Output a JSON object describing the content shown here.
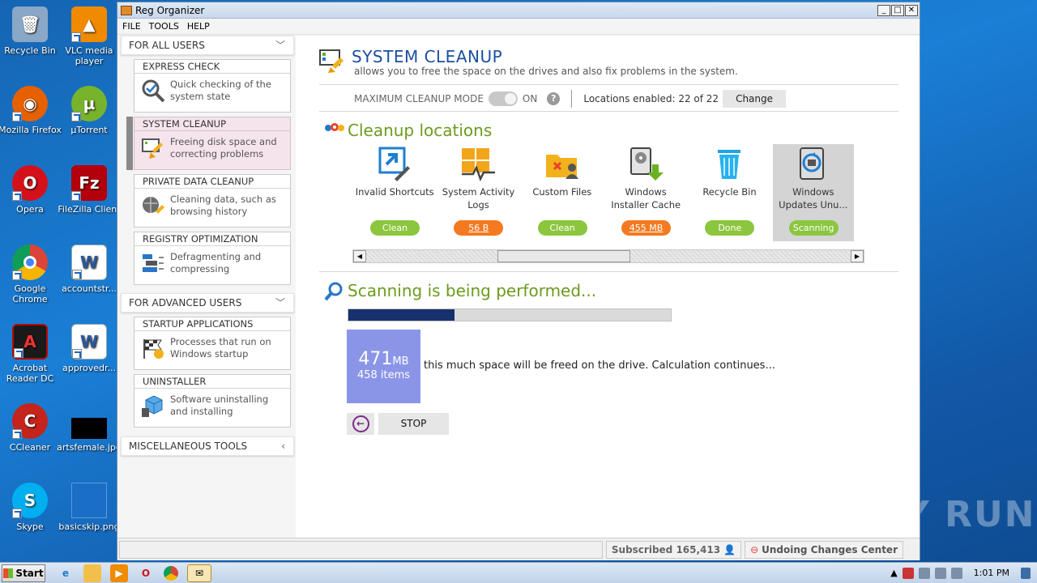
{
  "desktop": {
    "icons": [
      {
        "label": "Recycle Bin",
        "color": "#6e8db3"
      },
      {
        "label": "VLC media player",
        "color": "#f08a00"
      },
      {
        "label": "Mozilla Firefox",
        "color": "#e66000"
      },
      {
        "label": "µTorrent",
        "color": "#78b32c"
      },
      {
        "label": "Opera",
        "color": "#d4111b"
      },
      {
        "label": "FileZilla Client",
        "color": "#b3000c"
      },
      {
        "label": "Google Chrome",
        "color": "#4285f4"
      },
      {
        "label": "accountstr...",
        "color": "#2b5797"
      },
      {
        "label": "Acrobat Reader DC",
        "color": "#b30b00"
      },
      {
        "label": "approvedr...",
        "color": "#2b5797"
      },
      {
        "label": "CCleaner",
        "color": "#c4241c"
      },
      {
        "label": "artsfemale.jpg",
        "color": "#000000"
      },
      {
        "label": "Skype",
        "color": "#00aff0"
      },
      {
        "label": "basicskip.png",
        "color": "#1a6ec5"
      }
    ]
  },
  "window": {
    "title": "Reg Organizer",
    "menu": [
      "FILE",
      "TOOLS",
      "HELP"
    ]
  },
  "sidebar": {
    "section_all_users": "FOR ALL USERS",
    "section_advanced": "FOR ADVANCED USERS",
    "section_misc": "MISCELLANEOUS TOOLS",
    "cards": [
      {
        "title": "EXPRESS CHECK",
        "desc": "Quick checking of the system state"
      },
      {
        "title": "SYSTEM CLEANUP",
        "desc": "Freeing disk space and correcting problems"
      },
      {
        "title": "PRIVATE DATA CLEANUP",
        "desc": "Cleaning data, such as browsing history"
      },
      {
        "title": "REGISTRY OPTIMIZATION",
        "desc": "Defragmenting and compressing"
      },
      {
        "title": "STARTUP APPLICATIONS",
        "desc": "Processes that run on Windows startup"
      },
      {
        "title": "UNINSTALLER",
        "desc": "Software uninstalling and installing"
      }
    ]
  },
  "main": {
    "title": "SYSTEM CLEANUP",
    "subtitle": "allows you to free the space on the drives and also fix problems in the system.",
    "mode_label": "MAXIMUM CLEANUP MODE",
    "mode_state": "ON",
    "help": "?",
    "locations_enabled": "Locations enabled: 22 of 22",
    "change_label": "Change",
    "locations_title": "Cleanup locations",
    "tiles": [
      {
        "label": "Invalid Shortcuts",
        "badge": "Clean",
        "status": "green"
      },
      {
        "label": "System Activity Logs",
        "badge": "56 B",
        "status": "orange"
      },
      {
        "label": "Custom Files",
        "badge": "Clean",
        "status": "green"
      },
      {
        "label": "Windows Installer Cache",
        "badge": "455 MB",
        "status": "orange"
      },
      {
        "label": "Recycle Bin",
        "badge": "Done",
        "status": "green"
      },
      {
        "label": "Windows Updates Unu...",
        "badge": "Scanning",
        "status": "green"
      }
    ],
    "scan_title": "Scanning is being performed...",
    "progress": 0.33,
    "result_size": "471",
    "result_unit": "MB",
    "result_items": "458 items",
    "result_text": "this much space will be freed on the drive. Calculation continues...",
    "stop_label": "STOP"
  },
  "statusbar": {
    "subscribed": "Subscribed 165,413",
    "undo": "Undoing Changes Center"
  },
  "taskbar": {
    "start_label": "Start",
    "clock": "1:01 PM"
  },
  "watermark": "ANY RUN",
  "colors": {
    "accent_blue": "#1c4fa0",
    "accent_green": "#6b9b1e",
    "badge_green": "#8cc63f",
    "badge_orange": "#f47a20",
    "result_box": "#8b95e8",
    "progress_fill": "#16316b"
  }
}
